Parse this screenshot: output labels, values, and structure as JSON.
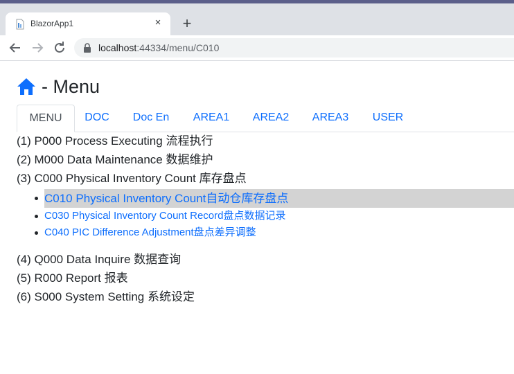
{
  "browser": {
    "tab_title": "BlazorApp1",
    "close_symbol": "×",
    "new_tab_symbol": "+",
    "url_host": "localhost",
    "url_rest": ":44334/menu/C010"
  },
  "page": {
    "title": "- Menu",
    "home_icon_color": "#0d6efd"
  },
  "nav_tabs": [
    {
      "label": "MENU",
      "active": true
    },
    {
      "label": "DOC"
    },
    {
      "label": "Doc En"
    },
    {
      "label": "AREA1"
    },
    {
      "label": "AREA2"
    },
    {
      "label": "AREA3"
    },
    {
      "label": "USER"
    }
  ],
  "menu": {
    "items": [
      "(1) P000 Process Executing 流程执行",
      "(2) M000 Data Maintenance 数据维护",
      "(3) C000 Physical Inventory Count 库存盘点"
    ],
    "sub_items": [
      "C010 Physical Inventory Count自动仓库存盘点",
      "C030 Physical Inventory Count Record盘点数据记录",
      "C040 PIC Difference Adjustment盘点差异调整"
    ],
    "items_after": [
      "(4) Q000 Data Inquire 数据查询",
      "(5) R000 Report 报表",
      "(6) S000 System Setting 系统设定"
    ]
  },
  "colors": {
    "link": "#0d6efd",
    "selected_bg": "#d3d3d3",
    "tabbar_bg": "#dee1e6"
  }
}
